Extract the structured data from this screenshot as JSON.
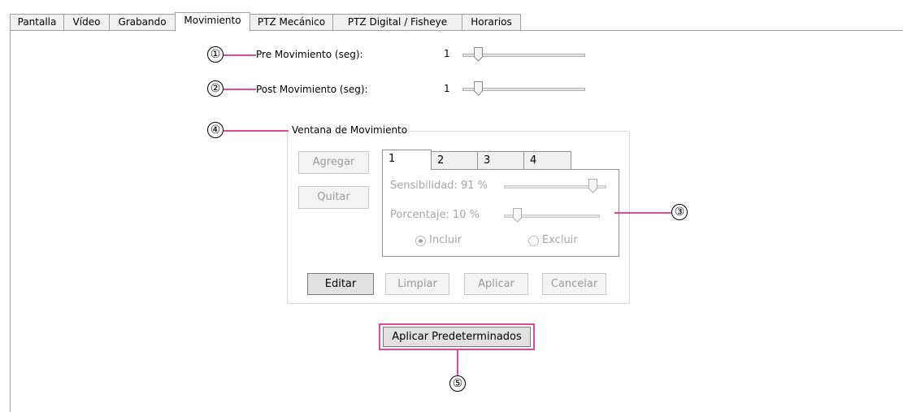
{
  "tabs": [
    "Pantalla",
    "Vídeo",
    "Grabando",
    "Movimiento",
    "PTZ Mecánico",
    "PTZ Digital / Fisheye",
    "Horarios"
  ],
  "callouts": {
    "c1": "①",
    "c2": "②",
    "c3": "③",
    "c4": "④",
    "c5": "⑤"
  },
  "pre_motion": {
    "label": "Pre Movimiento (seg):",
    "value": "1"
  },
  "post_motion": {
    "label": "Post Movimiento (seg):",
    "value": "1"
  },
  "motion_window": {
    "title": "Ventana de Movimiento",
    "add_label": "Agregar",
    "remove_label": "Quitar",
    "window_tabs": [
      "1",
      "2",
      "3",
      "4"
    ],
    "sensitivity_label": "Sensibilidad: 91 %",
    "sensitivity_level": 0.91,
    "percentage_label": "Porcentaje: 10 %",
    "percentage_level": 0.1,
    "include_label": "Incluir",
    "exclude_label": "Excluir",
    "edit_label": "Editar",
    "clear_label": "Limpiar",
    "apply_label": "Aplicar",
    "cancel_label": "Cancelar"
  },
  "apply_defaults_label": "Aplicar Predeterminados",
  "colors": {
    "callout_line": "#e8469a",
    "highlight_border": "#e8469a"
  }
}
